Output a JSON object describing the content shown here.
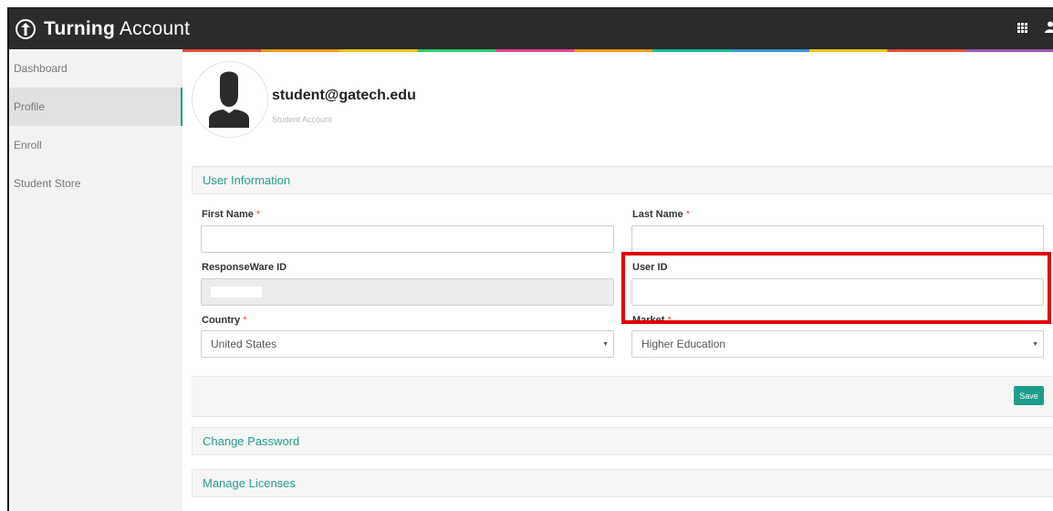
{
  "header": {
    "brand_bold": "Turning",
    "brand_rest": " Account",
    "icons": [
      "turning-logo-icon",
      "apps-grid-icon",
      "user-icon"
    ]
  },
  "sidebar": {
    "items": [
      {
        "label": "Dashboard"
      },
      {
        "label": "Profile",
        "active": true
      },
      {
        "label": "Enroll"
      },
      {
        "label": "Student Store"
      }
    ]
  },
  "profile": {
    "email": "student@gatech.edu",
    "account_type": "Student Account"
  },
  "user_info": {
    "title": "User Information",
    "required_mark": "*",
    "first_name": {
      "label": "First Name",
      "value": ""
    },
    "last_name": {
      "label": "Last Name",
      "value": ""
    },
    "responseware_id": {
      "label": "ResponseWare ID"
    },
    "user_id": {
      "label": "User ID",
      "value": ""
    },
    "country": {
      "label": "Country",
      "value": "United States"
    },
    "market": {
      "label": "Market",
      "value": "Higher Education"
    },
    "save_label": "Save"
  },
  "sections": {
    "change_password": "Change Password",
    "manage_licenses": "Manage Licenses"
  },
  "colors": {
    "accent": "#1e9d8b",
    "header_bg": "#2b2b2b",
    "highlight": "#e00000"
  }
}
